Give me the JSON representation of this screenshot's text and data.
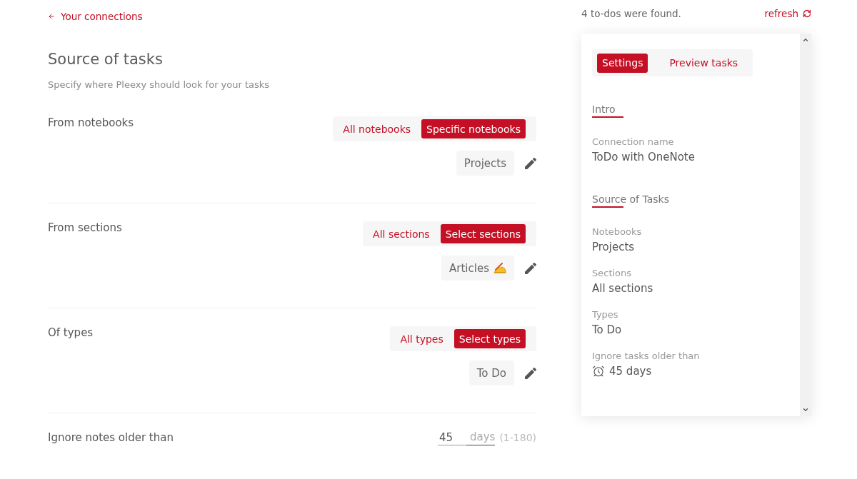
{
  "back_link": {
    "label": "Your connections"
  },
  "header": {
    "title": "Source of tasks",
    "subtitle": "Specify where Pleexy should look for your tasks"
  },
  "filters": [
    {
      "label": "From notebooks",
      "options": [
        {
          "label": "All notebooks",
          "selected": false
        },
        {
          "label": "Specific notebooks",
          "selected": true
        }
      ],
      "chips": [
        {
          "label": "Projects",
          "kind": "plain"
        }
      ]
    },
    {
      "label": "From sections",
      "options": [
        {
          "label": "All sections",
          "selected": false
        },
        {
          "label": "Select sections",
          "selected": true
        }
      ],
      "chips": [
        {
          "label": "Articles",
          "kind": "emoji"
        }
      ]
    },
    {
      "label": "Of types",
      "options": [
        {
          "label": "All types",
          "selected": false
        },
        {
          "label": "Select types",
          "selected": true
        }
      ],
      "chips": [
        {
          "label": "To Do",
          "kind": "plain"
        }
      ]
    }
  ],
  "age_limit": {
    "label": "Ignore notes older than",
    "value": "45",
    "unit": "days",
    "range": "(1-180)"
  },
  "summary": {
    "found": "4 to-dos were found.",
    "refresh": "refresh"
  },
  "panel": {
    "tabs": [
      {
        "label": "Settings",
        "selected": true
      },
      {
        "label": "Preview tasks",
        "selected": false
      }
    ],
    "groups": [
      {
        "heading": "Intro",
        "fields": [
          {
            "label": "Connection name",
            "value": "ToDo with OneNote",
            "kind": "text"
          }
        ]
      },
      {
        "heading": "Source of Tasks",
        "fields": [
          {
            "label": "Notebooks",
            "value": "Projects",
            "kind": "text"
          },
          {
            "label": "Sections",
            "value": "All sections",
            "kind": "text"
          },
          {
            "label": "Types",
            "value": "To Do",
            "kind": "text"
          },
          {
            "label": "Ignore tasks older than",
            "value": "45 days",
            "kind": "duration"
          }
        ]
      }
    ]
  }
}
